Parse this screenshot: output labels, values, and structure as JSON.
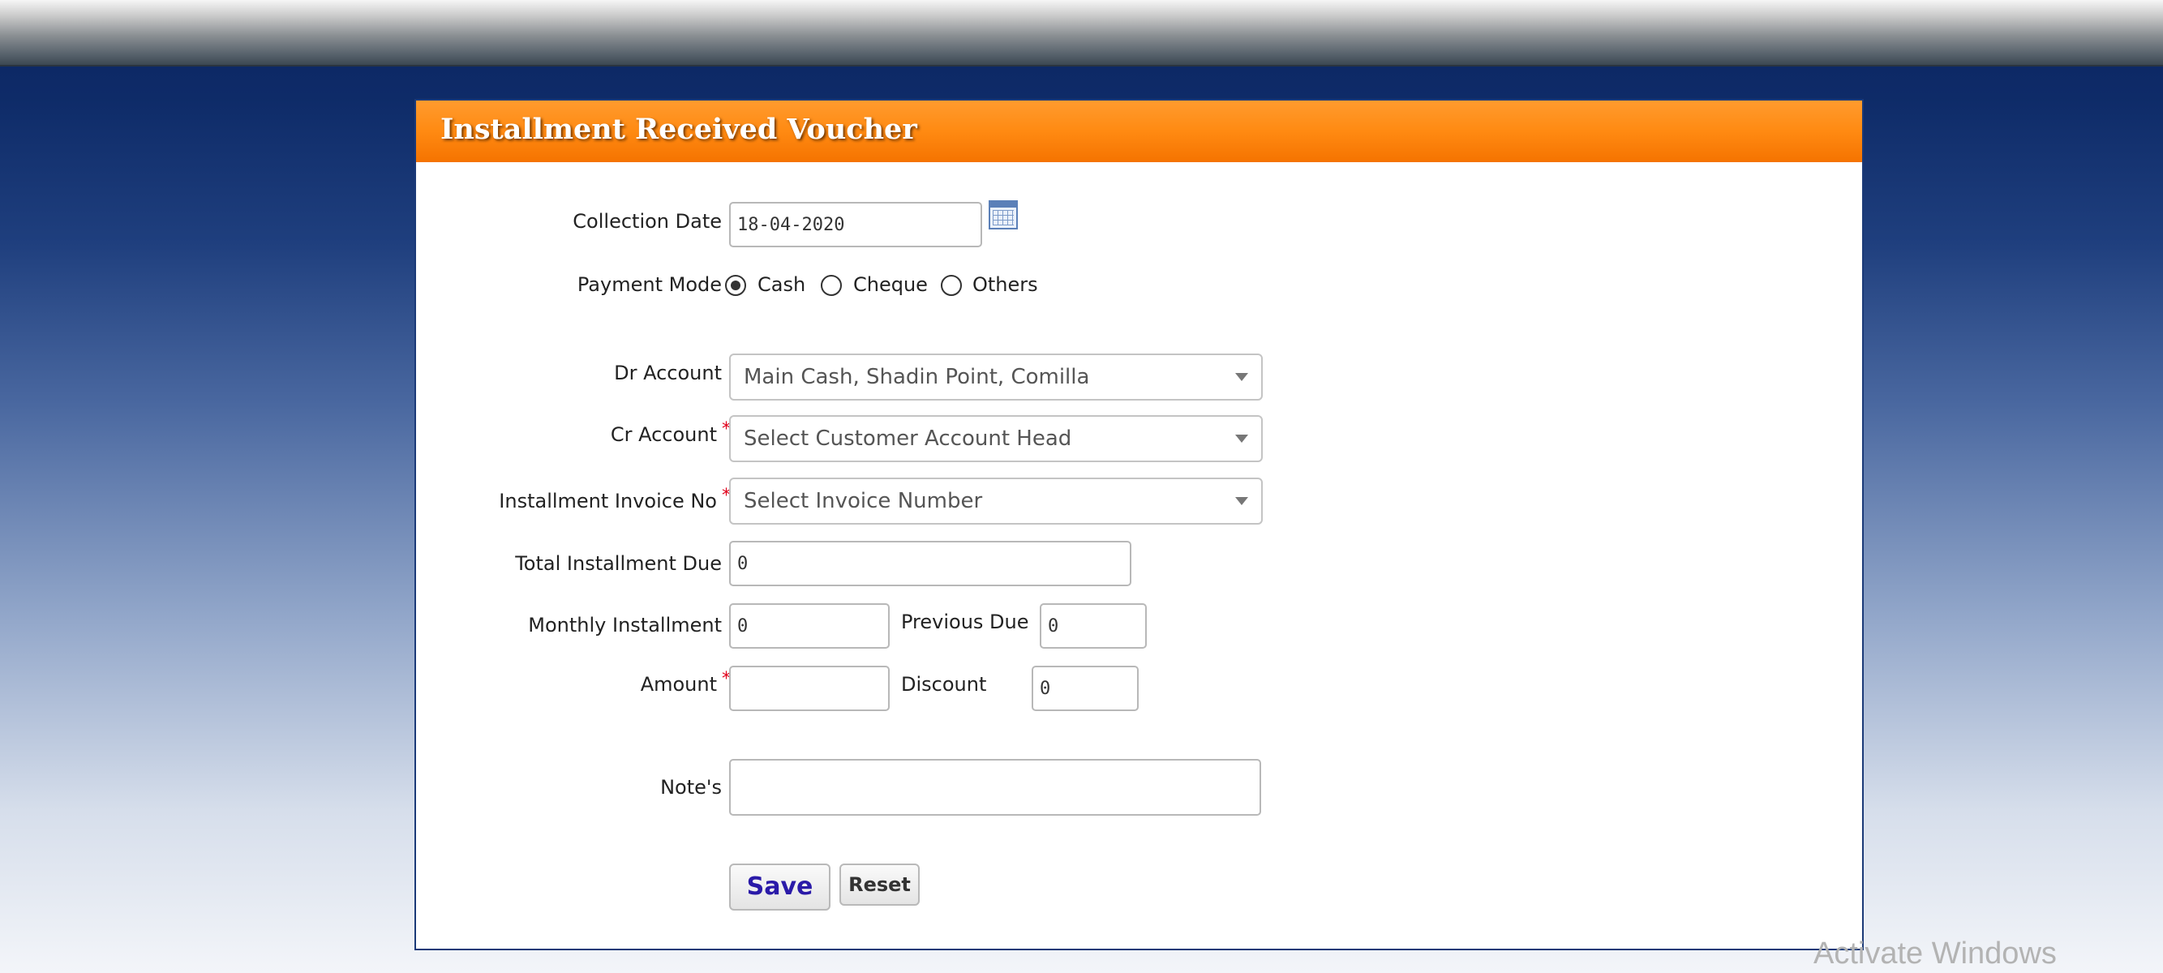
{
  "form": {
    "title": "Installment Received Voucher",
    "collection_date_label": "Collection Date",
    "collection_date_value": "18-04-2020",
    "payment_mode_label": "Payment Mode",
    "payment_modes": [
      {
        "label": "Cash",
        "selected": true
      },
      {
        "label": "Cheque",
        "selected": false
      },
      {
        "label": "Others",
        "selected": false
      }
    ],
    "dr_account_label": "Dr Account",
    "dr_account_value": "Main Cash, Shadin Point, Comilla",
    "cr_account_label": "Cr Account",
    "cr_account_placeholder": "Select Customer Account Head",
    "invoice_label": "Installment Invoice No",
    "invoice_placeholder": "Select Invoice Number",
    "total_due_label": "Total Installment Due",
    "total_due_value": "0",
    "monthly_label": "Monthly Installment",
    "monthly_value": "0",
    "previous_due_label": "Previous Due",
    "previous_due_value": "0",
    "amount_label": "Amount",
    "amount_value": "",
    "discount_label": "Discount",
    "discount_value": "0",
    "notes_label": "Note's",
    "notes_value": "",
    "required_mark": "*",
    "save_label": "Save",
    "reset_label": "Reset"
  },
  "colors": {
    "header_orange": "#ff8a12",
    "save_text": "#2a1aa8",
    "required": "#e0001a"
  },
  "watermark": "Activate Windows"
}
